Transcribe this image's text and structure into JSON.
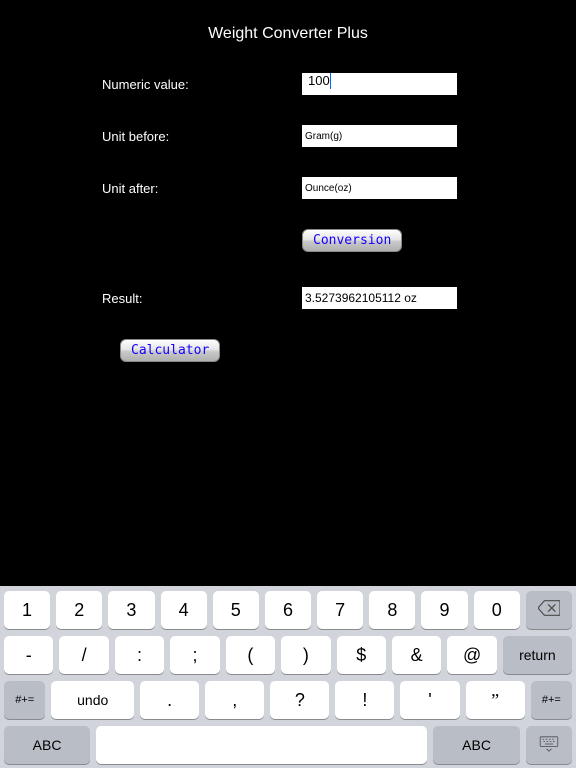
{
  "app": {
    "title": "Weight Converter Plus"
  },
  "form": {
    "numeric_label": "Numeric value:",
    "numeric_value": "100",
    "unit_before_label": "Unit before:",
    "unit_before_value": "Gram(g)",
    "unit_after_label": "Unit after:",
    "unit_after_value": "Ounce(oz)",
    "conversion_button": "Conversion",
    "result_label": "Result:",
    "result_value": "3.5273962105112 oz",
    "calculator_button": "Calculator"
  },
  "keyboard": {
    "row1": [
      "1",
      "2",
      "3",
      "4",
      "5",
      "6",
      "7",
      "8",
      "9",
      "0"
    ],
    "row2": [
      "-",
      "/",
      ":",
      ";",
      "(",
      ")",
      "$",
      "&",
      "@"
    ],
    "return": "return",
    "row3_side": "#+=",
    "undo": "undo",
    "row3_main": [
      ".",
      ",",
      "?",
      "!",
      "'",
      "”"
    ],
    "abc": "ABC"
  }
}
